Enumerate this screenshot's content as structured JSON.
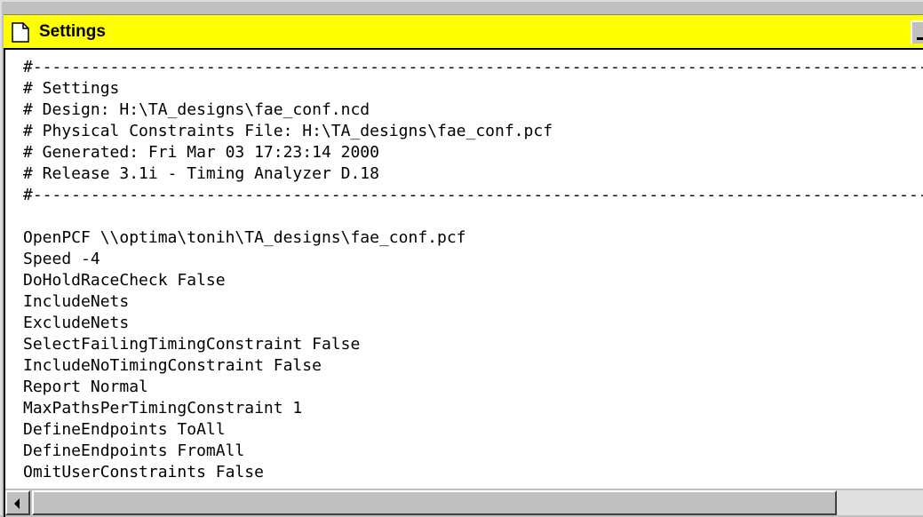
{
  "window": {
    "title": "Settings",
    "title_bar_color": "#ffff00",
    "icon": "document-icon"
  },
  "content": {
    "lines": [
      "#----------------------------------------------------------------------------------------------",
      "# Settings",
      "# Design: H:\\TA_designs\\fae_conf.ncd",
      "# Physical Constraints File: H:\\TA_designs\\fae_conf.pcf",
      "# Generated: Fri Mar 03 17:23:14 2000",
      "# Release 3.1i - Timing Analyzer D.18",
      "#----------------------------------------------------------------------------------------------",
      "",
      "OpenPCF \\\\optima\\tonih\\TA_designs\\fae_conf.pcf",
      "Speed -4",
      "DoHoldRaceCheck False",
      "IncludeNets",
      "ExcludeNets",
      "SelectFailingTimingConstraint False",
      "IncludeNoTimingConstraint False",
      "Report Normal",
      "MaxPathsPerTimingConstraint 1",
      "DefineEndpoints ToAll",
      "DefineEndpoints FromAll",
      "OmitUserConstraints False"
    ]
  },
  "scrollbar": {
    "left_arrow_icon": "arrow-left-icon"
  }
}
